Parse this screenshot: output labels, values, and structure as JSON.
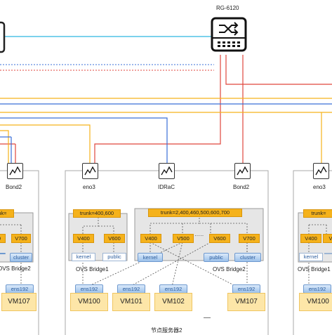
{
  "switch": {
    "name": "RG-6120",
    "icon": "network-switch-icon"
  },
  "colors": {
    "cyan": "#2fb6e0",
    "red": "#e0463c",
    "orange": "#f5b21b",
    "blue": "#3a6fd8",
    "vlan": "#f5b21b",
    "vm": "#fde6a8",
    "host_border": "#a9a9a9"
  },
  "left_server": {
    "nic": "Bond2",
    "trunk": "trunk=",
    "vlans": [
      "0",
      "V700"
    ],
    "pills": [
      "",
      "cluster"
    ],
    "bridge_label": "OVS Bridge2",
    "ens": "ens192",
    "vm": "VM107"
  },
  "middle_server": {
    "caption": "节点服务器2",
    "nics": [
      "eno3",
      "IDRaC",
      "Bond2"
    ],
    "bridge1": {
      "label": "OVS Bridge1",
      "trunk": "trunk=400,600",
      "vlans": [
        "V400",
        "V600"
      ],
      "pills": [
        "kernel",
        "public"
      ]
    },
    "bridge2": {
      "label": "OVS Bridge2",
      "trunk": "trunk=2,400,460,500,600,700",
      "vlans": [
        "V400",
        "V500",
        "V600",
        "V700"
      ],
      "pills": [
        "kernel",
        "public",
        "cluster"
      ]
    },
    "ens": [
      "ens192",
      "ens192",
      "ens192",
      "ens192"
    ],
    "vms": [
      "VM100",
      "VM101",
      "VM102",
      "VM107"
    ],
    "ellipsis_top": "·····",
    "ellipsis_vm": "—"
  },
  "right_server": {
    "nic": "eno3",
    "trunk": "trunk=",
    "vlans": [
      "V400",
      "V"
    ],
    "pills": [
      "kernel",
      ""
    ],
    "bridge_label": "OVS Bridge1",
    "ens": "ens192",
    "vm": "VM100"
  }
}
